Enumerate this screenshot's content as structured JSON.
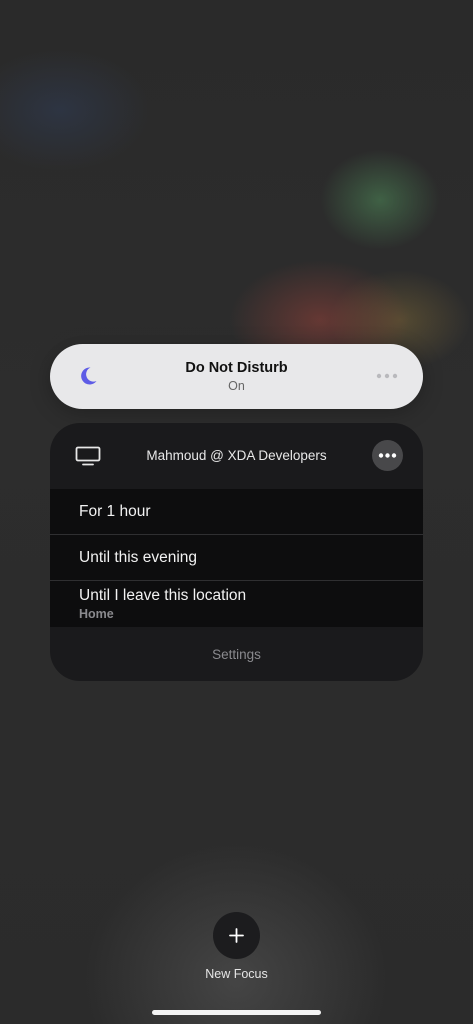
{
  "focus_mode": {
    "title": "Do Not Disturb",
    "status": "On",
    "icon": "moon-icon",
    "accent_color": "#5e5ce6"
  },
  "options_card": {
    "device_icon": "monitor-icon",
    "device_name": "Mahmoud @ XDA Developers",
    "options": [
      {
        "label": "For 1 hour"
      },
      {
        "label": "Until this evening"
      },
      {
        "label": "Until I leave this location",
        "sublabel": "Home"
      }
    ],
    "settings_label": "Settings"
  },
  "new_focus": {
    "label": "New Focus",
    "icon": "plus-icon"
  }
}
